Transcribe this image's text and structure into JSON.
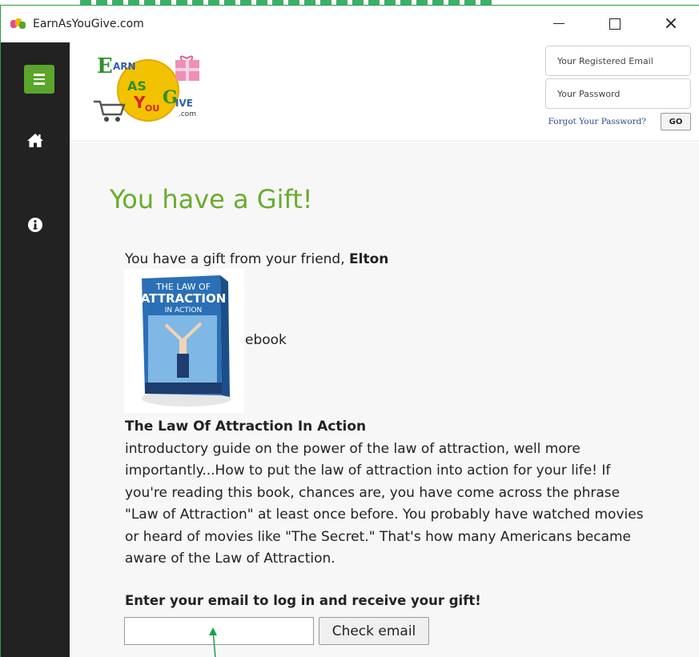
{
  "window": {
    "title": "EarnAsYouGive.com",
    "controls": {
      "minimize": "minimize-icon",
      "maximize": "maximize-icon",
      "close": "×"
    }
  },
  "sidebar": {
    "items": [
      {
        "icon": "menu-icon",
        "color": "#5aa52a"
      },
      {
        "icon": "home-icon"
      },
      {
        "icon": "info-icon"
      }
    ]
  },
  "header": {
    "logo_alt": "EarnAsYouGive.com",
    "logo_text": "Earn As You Give .com",
    "email_placeholder": "Your Registered Email",
    "password_placeholder": "Your Password",
    "forgot_label": "Forgot Your Password?",
    "go_label": "GO"
  },
  "main": {
    "title": "You have a Gift!",
    "intro_prefix": "You have a gift from your friend, ",
    "friend_name": "Elton",
    "gift_type": "ebook",
    "book_cover_text": [
      "THE LAW OF",
      "ATTRACTION",
      "IN ACTION"
    ],
    "book_title": "The Law Of Attraction In Action",
    "book_description": "introductory guide on the power of the law of attraction, well more importantly...How to put the law of attraction into action for your life! If you're reading this book, chances are, you have come across the phrase \"Law of Attraction\" at least once before. You probably have watched movies or heard of movies like \"The Secret.\" That's how many Americans became aware of the Law of Attraction.",
    "cta": "Enter your email to log in and receive your gift!",
    "email_value": "",
    "check_button": "Check email"
  },
  "colors": {
    "accent": "#6aac2c",
    "sidebar_bg": "#222222",
    "link": "#2b4c8c"
  }
}
